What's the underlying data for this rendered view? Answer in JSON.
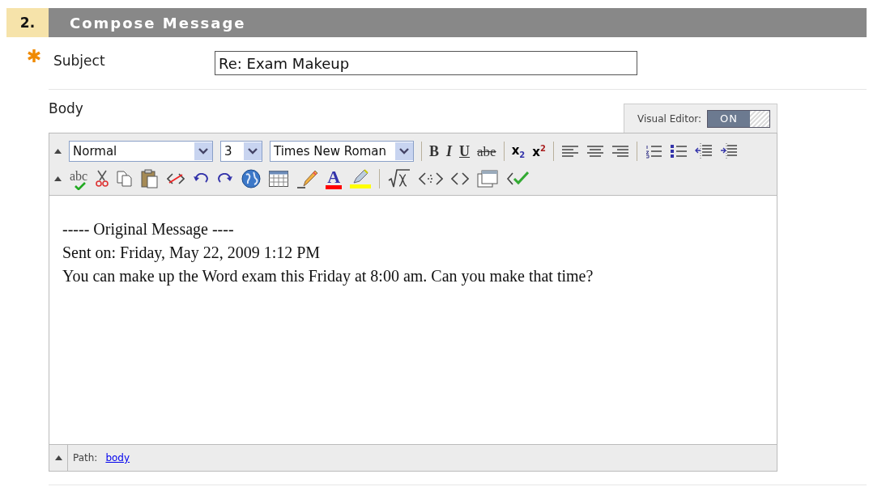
{
  "section": {
    "number": "2.",
    "title": "Compose Message"
  },
  "subject": {
    "required": true,
    "label": "Subject",
    "value": "Re: Exam Makeup"
  },
  "body": {
    "label": "Body",
    "visual_editor": {
      "label": "Visual Editor:",
      "state_label": "ON",
      "on": true
    },
    "toolbar_rows": [
      [
        {
          "kind": "collapse"
        },
        {
          "kind": "select",
          "value": "Normal"
        },
        {
          "kind": "select",
          "value": "3"
        },
        {
          "kind": "select",
          "value": "Times New Roman"
        },
        {
          "kind": "separator"
        },
        {
          "kind": "bold",
          "label": "B"
        },
        {
          "kind": "italic",
          "label": "I"
        },
        {
          "kind": "underline",
          "label": "U"
        },
        {
          "kind": "strike",
          "label": "abe"
        },
        {
          "kind": "separator"
        },
        {
          "kind": "subscript",
          "label": "x$_{2}$"
        },
        {
          "kind": "superscript",
          "label": "x$^{2}$"
        },
        {
          "kind": "separator"
        },
        {
          "kind": "align-left"
        },
        {
          "kind": "align-center"
        },
        {
          "kind": "align-right"
        },
        {
          "kind": "separator"
        },
        {
          "kind": "ordered-list"
        },
        {
          "kind": "bullet-list"
        },
        {
          "kind": "outdent"
        },
        {
          "kind": "indent"
        }
      ],
      [
        {
          "kind": "collapse"
        },
        {
          "kind": "spellcheck",
          "label": "abc"
        },
        {
          "kind": "cut"
        },
        {
          "kind": "copy"
        },
        {
          "kind": "paste"
        },
        {
          "kind": "remove-format"
        },
        {
          "kind": "undo"
        },
        {
          "kind": "redo"
        },
        {
          "kind": "link"
        },
        {
          "kind": "table"
        },
        {
          "kind": "pencil"
        },
        {
          "kind": "font-color",
          "label": "A"
        },
        {
          "kind": "highlight"
        },
        {
          "kind": "separator"
        },
        {
          "kind": "math"
        },
        {
          "kind": "anchor"
        },
        {
          "kind": "code"
        },
        {
          "kind": "preview"
        },
        {
          "kind": "check"
        }
      ]
    ],
    "content": [
      "----- Original Message ----",
      "Sent on: Friday, May 22, 2009 1:12 PM",
      "You can make up the Word exam this Friday at 8:00 am. Can you make that time?"
    ],
    "path": {
      "label": "Path:",
      "link": "body"
    }
  }
}
